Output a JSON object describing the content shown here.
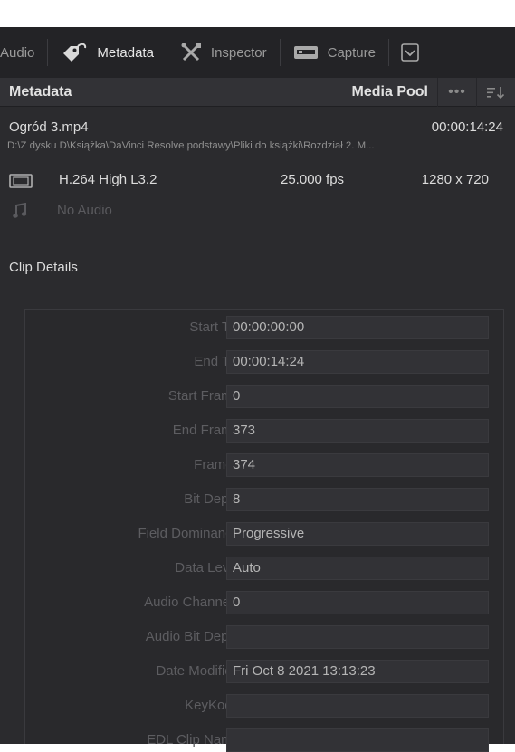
{
  "tabs": [
    {
      "label": "Audio",
      "icon": "audio-tab-partial"
    },
    {
      "label": "Metadata",
      "icon": "metadata-tag-icon"
    },
    {
      "label": "Inspector",
      "icon": "inspector-tools-icon"
    },
    {
      "label": "Capture",
      "icon": "capture-deck-icon"
    }
  ],
  "active_tab": "Metadata",
  "panel": {
    "title": "Metadata",
    "media_pool_label": "Media Pool",
    "more_label": "•••"
  },
  "clip": {
    "filename": "Ogród 3.mp4",
    "duration": "00:00:14:24",
    "path": "D:\\Z dysku D\\Książka\\DaVinci Resolve podstawy\\Pliki do książki\\Rozdział 2. M...",
    "codec": "H.264 High L3.2",
    "fps": "25.000 fps",
    "resolution": "1280 x 720",
    "audio": "No Audio"
  },
  "details": {
    "title": "Clip Details",
    "fields": [
      {
        "label": "Start TC",
        "value": "00:00:00:00"
      },
      {
        "label": "End TC",
        "value": "00:00:14:24"
      },
      {
        "label": "Start Frame",
        "value": "0"
      },
      {
        "label": "End Frame",
        "value": "373"
      },
      {
        "label": "Frames",
        "value": "374"
      },
      {
        "label": "Bit Depth",
        "value": "8"
      },
      {
        "label": "Field Dominance",
        "value": "Progressive"
      },
      {
        "label": "Data Level",
        "value": "Auto"
      },
      {
        "label": "Audio Channels",
        "value": "0"
      },
      {
        "label": "Audio Bit Depth",
        "value": ""
      },
      {
        "label": "Date Modified",
        "value": "Fri Oct 8 2021 13:13:23"
      },
      {
        "label": "KeyKode",
        "value": ""
      },
      {
        "label": "EDL Clip Name",
        "value": ""
      }
    ]
  },
  "colors": {
    "background": "#2b2b2e",
    "tabbar": "#232326",
    "header": "#323236",
    "field": "#323236",
    "label_dim": "#5d5d61",
    "text": "#dcdcdc"
  }
}
